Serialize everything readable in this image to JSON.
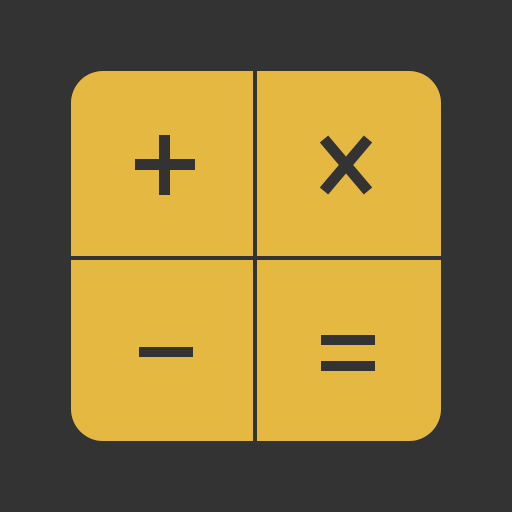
{
  "app_icon": {
    "name": "calculator",
    "colors": {
      "background": "#333333",
      "tile": "#E5B941",
      "ink": "#333333"
    },
    "keys": [
      {
        "symbol": "+",
        "icon": "plus-icon"
      },
      {
        "symbol": "X",
        "icon": "times-icon"
      },
      {
        "symbol": "−",
        "icon": "minus-icon"
      },
      {
        "symbol": "=",
        "icon": "equals-icon"
      }
    ]
  }
}
